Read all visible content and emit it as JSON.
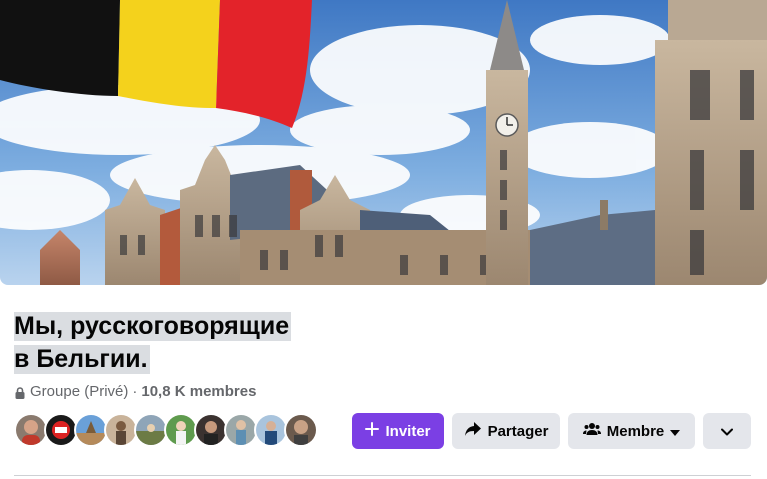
{
  "group": {
    "title_line1": "Мы, русскоговорящие",
    "title_line2": "в Бельгии.",
    "type": "Groupe (Privé)",
    "separator": "·",
    "members": "10,8 K membres"
  },
  "member_avatars": [
    {
      "name": "member-avatar-1"
    },
    {
      "name": "member-avatar-2"
    },
    {
      "name": "member-avatar-3"
    },
    {
      "name": "member-avatar-4"
    },
    {
      "name": "member-avatar-5"
    },
    {
      "name": "member-avatar-6"
    },
    {
      "name": "member-avatar-7"
    },
    {
      "name": "member-avatar-8"
    },
    {
      "name": "member-avatar-9"
    },
    {
      "name": "member-avatar-10"
    }
  ],
  "actions": {
    "invite_label": "Inviter",
    "share_label": "Partager",
    "member_label": "Membre"
  },
  "icons": {
    "lock": "lock-icon",
    "plus": "plus-icon",
    "share": "share-arrow-icon",
    "people": "people-icon",
    "caret": "caret-down-icon",
    "chevron": "chevron-down-icon"
  },
  "colors": {
    "accent": "#7b3fe4",
    "secondary_button": "#e4e6eb",
    "meta_text": "#65676b",
    "title_highlight": "#dadde1",
    "flag_black": "#111111",
    "flag_yellow": "#f4d21c",
    "flag_red": "#e3232a"
  }
}
